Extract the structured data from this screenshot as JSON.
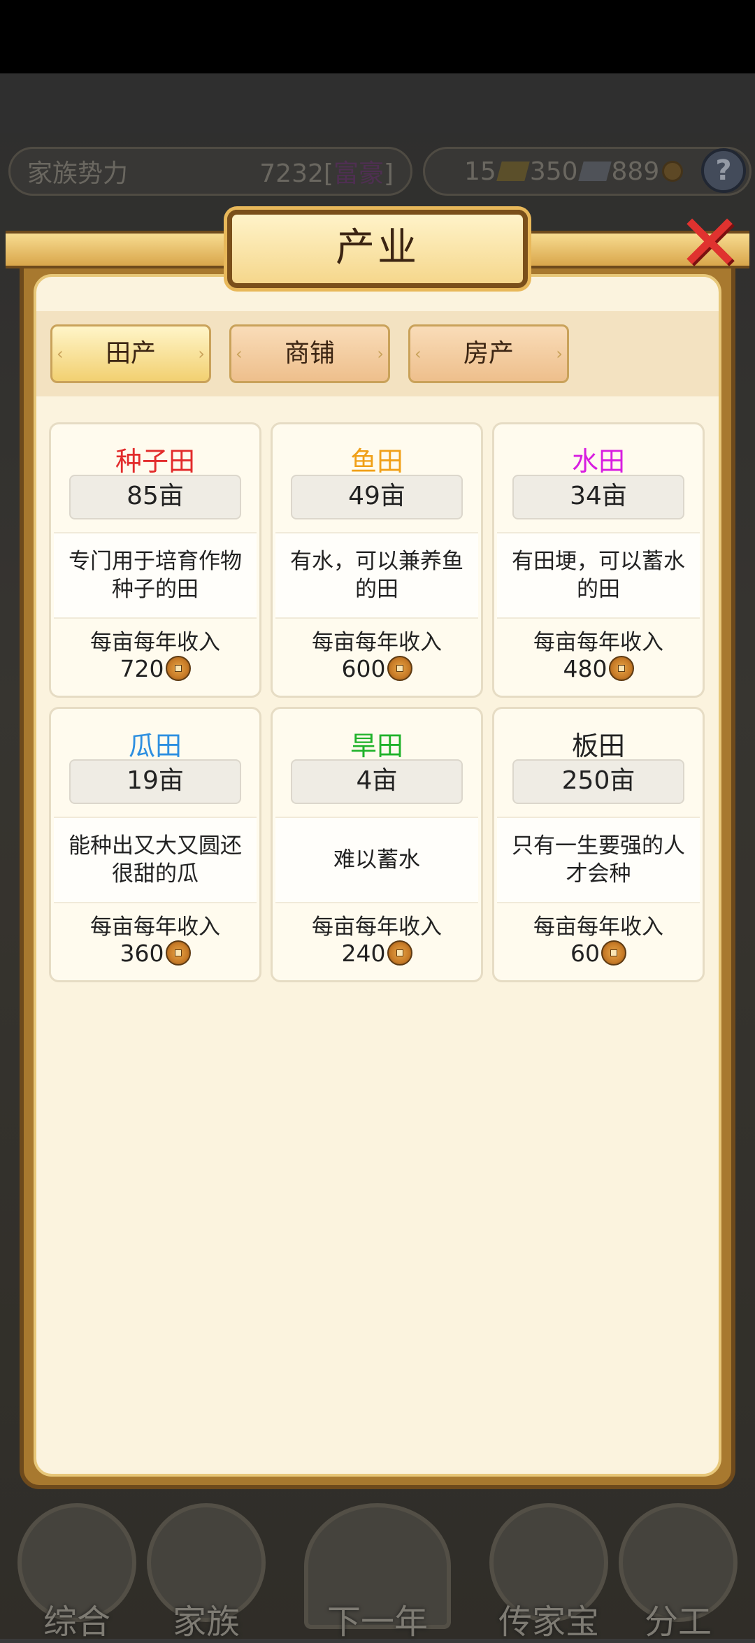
{
  "hud": {
    "clan_power_label": "家族势力",
    "clan_power_value": "7232",
    "clan_power_bracket_open": "[",
    "clan_power_tag": "富豪",
    "clan_power_bracket_close": "]",
    "gold": "15",
    "silver": "350",
    "coins": "889",
    "help": "?"
  },
  "panel": {
    "title": "产业",
    "close_glyph": "✕"
  },
  "tabs": [
    {
      "label": "田产",
      "active": true
    },
    {
      "label": "商铺",
      "active": false
    },
    {
      "label": "房产",
      "active": false
    }
  ],
  "income_label": "每亩每年收入",
  "fields": [
    {
      "name": "种子田",
      "color": "#e22b2b",
      "count": "85亩",
      "desc": "专门用于培育作物种子的田",
      "income": "720"
    },
    {
      "name": "鱼田",
      "color": "#f0a018",
      "count": "49亩",
      "desc": "有水，可以兼养鱼的田",
      "income": "600"
    },
    {
      "name": "水田",
      "color": "#d81ee0",
      "count": "34亩",
      "desc": "有田埂，可以蓄水的田",
      "income": "480"
    },
    {
      "name": "瓜田",
      "color": "#2d8fe0",
      "count": "19亩",
      "desc": "能种出又大又圆还很甜的瓜",
      "income": "360"
    },
    {
      "name": "旱田",
      "color": "#1fb22a",
      "count": "4亩",
      "desc": "难以蓄水",
      "income": "240"
    },
    {
      "name": "板田",
      "color": "#222222",
      "count": "250亩",
      "desc": "只有一生要强的人才会种",
      "income": "60"
    }
  ],
  "bottom_nav": [
    {
      "label": "综合"
    },
    {
      "label": "家族"
    },
    {
      "label": "下一年"
    },
    {
      "label": "传家宝"
    },
    {
      "label": "分工"
    }
  ]
}
